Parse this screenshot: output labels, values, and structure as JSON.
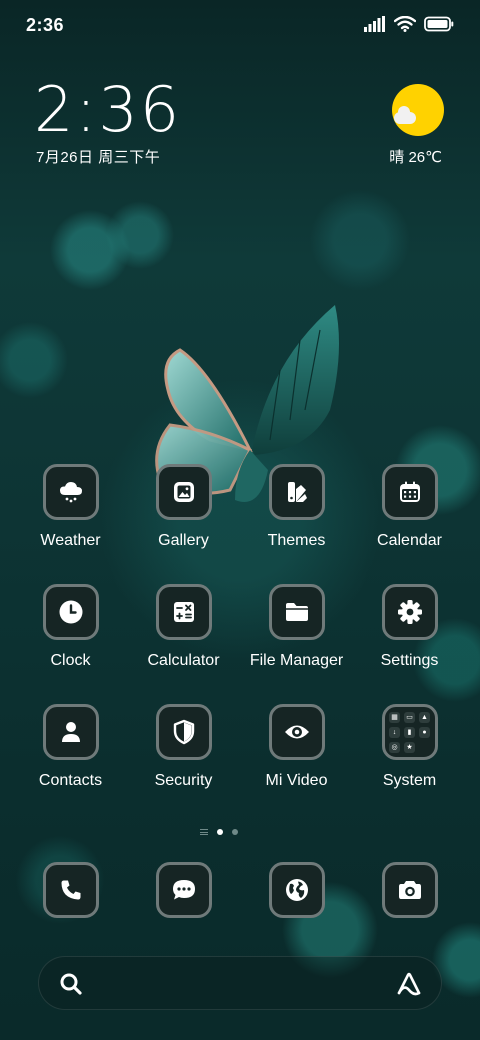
{
  "status_bar": {
    "time": "2:36"
  },
  "lockclock": {
    "time": "2:36",
    "date": "7月26日 周三下午"
  },
  "weather_widget": {
    "text": "晴 26℃"
  },
  "apps": [
    {
      "label": "Weather",
      "icon": "cloud-rain-icon"
    },
    {
      "label": "Gallery",
      "icon": "image-icon"
    },
    {
      "label": "Themes",
      "icon": "brush-icon"
    },
    {
      "label": "Calendar",
      "icon": "calendar-icon"
    },
    {
      "label": "Clock",
      "icon": "clock-icon"
    },
    {
      "label": "Calculator",
      "icon": "calculator-icon"
    },
    {
      "label": "File Manager",
      "icon": "folder-icon"
    },
    {
      "label": "Settings",
      "icon": "gear-icon"
    },
    {
      "label": "Contacts",
      "icon": "person-icon"
    },
    {
      "label": "Security",
      "icon": "shield-icon"
    },
    {
      "label": "Mi Video",
      "icon": "eye-icon"
    },
    {
      "label": "System",
      "icon": "folder-grid-icon"
    }
  ],
  "dock": [
    {
      "icon": "phone-icon"
    },
    {
      "icon": "chat-icon"
    },
    {
      "icon": "globe-icon"
    },
    {
      "icon": "camera-icon"
    }
  ],
  "pager": {
    "pages": 2,
    "current": 1
  },
  "colors": {
    "sun": "#ffd200",
    "icon_bg": "#162524",
    "icon_border": "#6f7a7a"
  }
}
